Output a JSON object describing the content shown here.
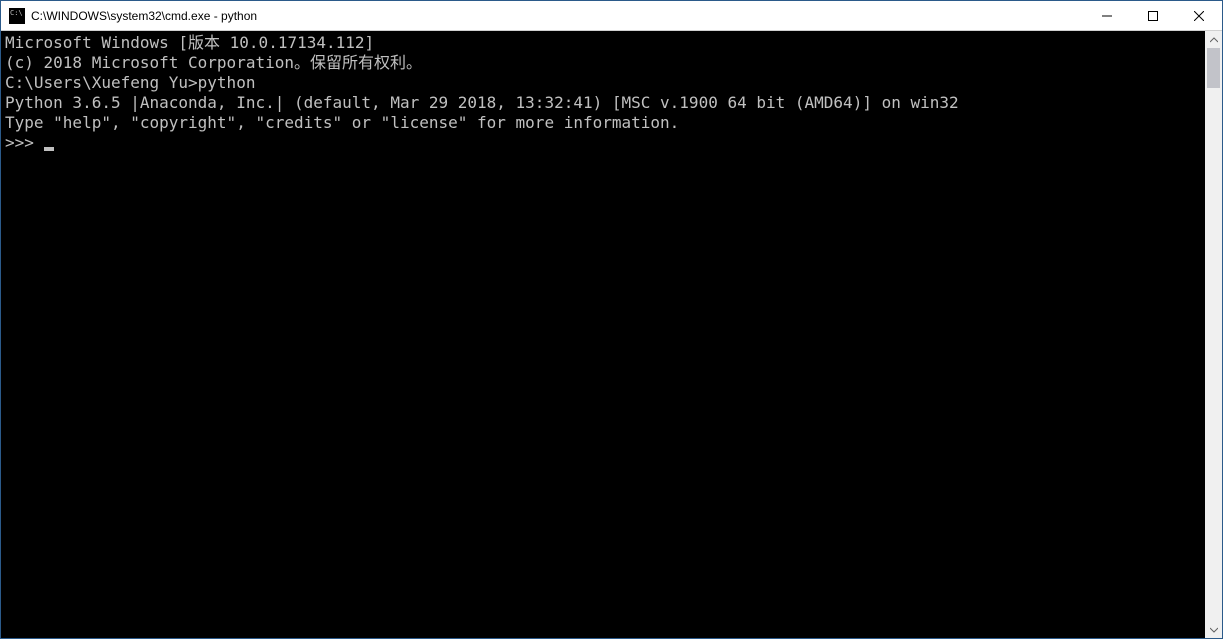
{
  "window": {
    "title": "C:\\WINDOWS\\system32\\cmd.exe - python"
  },
  "terminal": {
    "lines": [
      "Microsoft Windows [版本 10.0.17134.112]",
      "(c) 2018 Microsoft Corporation。保留所有权利。",
      "",
      "C:\\Users\\Xuefeng Yu>python",
      "Python 3.6.5 |Anaconda, Inc.| (default, Mar 29 2018, 13:32:41) [MSC v.1900 64 bit (AMD64)] on win32",
      "Type \"help\", \"copyright\", \"credits\" or \"license\" for more information."
    ],
    "prompt": ">>> "
  }
}
